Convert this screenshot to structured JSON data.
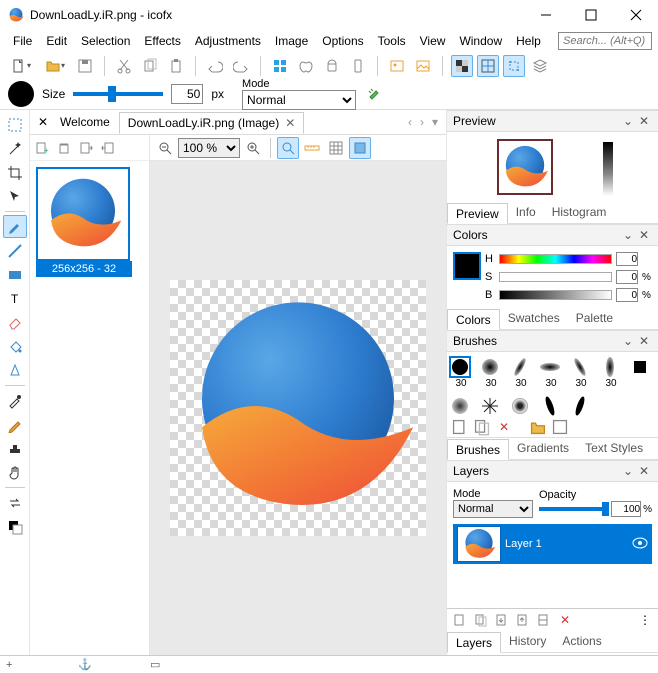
{
  "window": {
    "title": "DownLoadLy.iR.png - icofx"
  },
  "menu": [
    "File",
    "Edit",
    "Selection",
    "Effects",
    "Adjustments",
    "Image",
    "Options",
    "Tools",
    "View",
    "Window",
    "Help"
  ],
  "search": {
    "placeholder": "Search... (Alt+Q)"
  },
  "brush": {
    "size_label": "Size",
    "size_value": "50",
    "size_unit": "px",
    "mode_label": "Mode",
    "mode_value": "Normal"
  },
  "tabs": {
    "welcome": "Welcome",
    "active": "DownLoadLy.iR.png (Image)"
  },
  "thumb": {
    "caption": "256x256 - 32"
  },
  "zoom": {
    "value": "100 %"
  },
  "preview": {
    "title": "Preview",
    "tabs": [
      "Preview",
      "Info",
      "Histogram"
    ]
  },
  "colors": {
    "title": "Colors",
    "h": "H",
    "s": "S",
    "b": "B",
    "h_val": "0",
    "s_val": "0",
    "b_val": "0",
    "pct": "%",
    "tabs": [
      "Colors",
      "Swatches",
      "Palette"
    ]
  },
  "brushes": {
    "title": "Brushes",
    "sizes": [
      "30",
      "30",
      "30",
      "30",
      "30",
      "30"
    ],
    "tabs": [
      "Brushes",
      "Gradients",
      "Text Styles"
    ]
  },
  "layers": {
    "title": "Layers",
    "mode_label": "Mode",
    "mode_value": "Normal",
    "opacity_label": "Opacity",
    "opacity_value": "100",
    "opacity_pct": "%",
    "layer1": "Layer 1",
    "tabs": [
      "Layers",
      "History",
      "Actions"
    ]
  }
}
